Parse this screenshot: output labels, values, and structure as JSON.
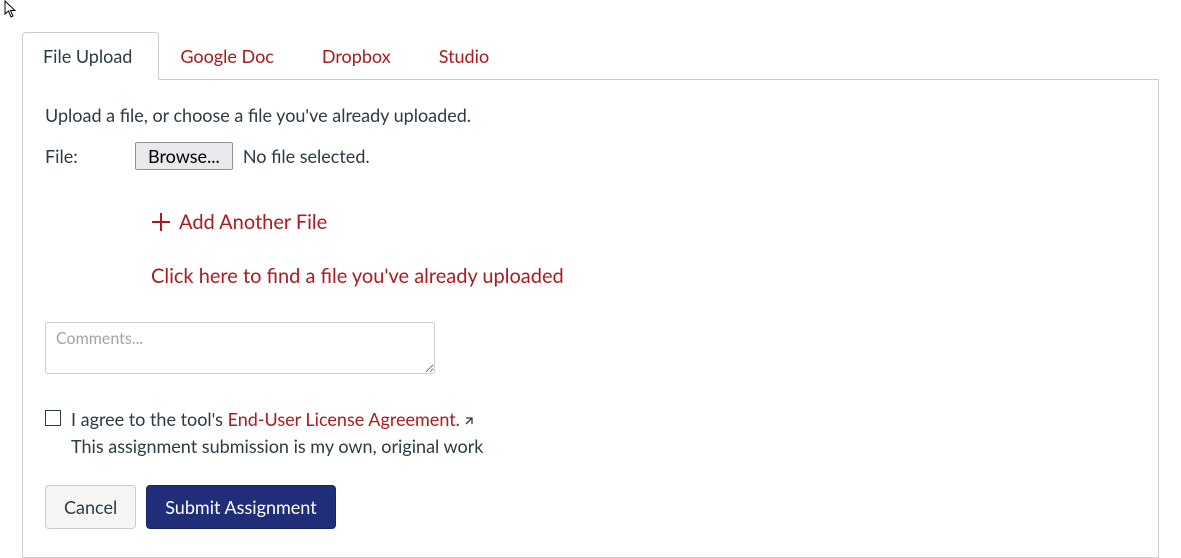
{
  "tabs": {
    "file_upload": "File Upload",
    "google_doc": "Google Doc",
    "dropbox": "Dropbox",
    "studio": "Studio"
  },
  "panel": {
    "intro": "Upload a file, or choose a file you've already uploaded.",
    "file_label": "File:",
    "browse_label": "Browse...",
    "no_file_text": "No file selected.",
    "add_another": "Add Another File",
    "find_existing": "Click here to find a file you've already uploaded",
    "comments_placeholder": "Comments...",
    "agree_prefix": "I agree to the tool's ",
    "eula_text": "End-User License Agreement.",
    "original_work": "This assignment submission is my own, original work",
    "cancel_label": "Cancel",
    "submit_label": "Submit Assignment"
  }
}
